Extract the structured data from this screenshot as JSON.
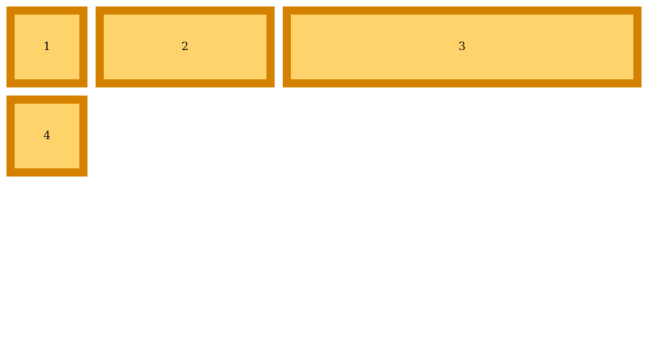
{
  "colors": {
    "box_border": "#d58100",
    "box_fill": "#ffd36b",
    "page_background": "#ffffff"
  },
  "boxes": [
    {
      "label": "1"
    },
    {
      "label": "2"
    },
    {
      "label": "3"
    },
    {
      "label": "4"
    }
  ]
}
